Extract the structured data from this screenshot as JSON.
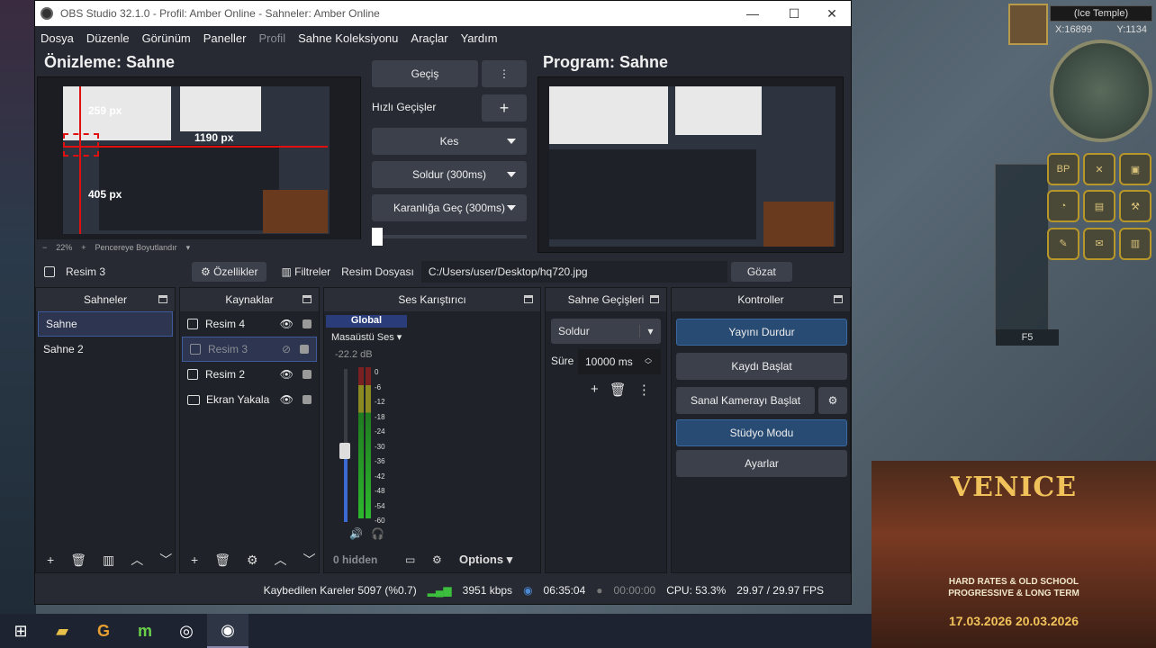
{
  "window": {
    "title": "OBS Studio 32.1.0 - Profil: Amber Online - Sahneler: Amber Online",
    "controls": {
      "minimize": "—",
      "maximize": "☐",
      "close": "✕"
    }
  },
  "menu": [
    "Dosya",
    "Düzenle",
    "Görünüm",
    "Paneller",
    "Profil",
    "Sahne Koleksiyonu",
    "Araçlar",
    "Yardım"
  ],
  "preview": {
    "title": "Önizleme: Sahne",
    "labels": {
      "top": "259 px",
      "right": "1190 px",
      "left": "405 px"
    },
    "zoom": "22%",
    "resize_label": "Pencereye Boyutlandır"
  },
  "program": {
    "title": "Program: Sahne"
  },
  "transitions": {
    "gecis": "Geçiş",
    "quick": "Hızlı Geçişler",
    "cut": "Kes",
    "fade": "Soldur (300ms)",
    "fade_black": "Karanlığa Geç (300ms)"
  },
  "sourcebar": {
    "selected": "Resim 3",
    "properties": "Özellikler",
    "filters": "Filtreler",
    "file_label": "Resim Dosyası",
    "path": "C:/Users/user/Desktop/hq720.jpg",
    "browse": "Gözat"
  },
  "scenes": {
    "header": "Sahneler",
    "items": [
      "Sahne",
      "Sahne 2"
    ]
  },
  "sources": {
    "header": "Kaynaklar",
    "items": [
      "Resim 4",
      "Resim 3",
      "Resim 2",
      "Ekran Yakala"
    ]
  },
  "mixer": {
    "header": "Ses Karıştırıcı",
    "tab": "Global",
    "device": "Masaüstü Ses",
    "level": "-22.2 dB",
    "scale": [
      "0",
      "-6",
      "-12",
      "-18",
      "-24",
      "-30",
      "-36",
      "-42",
      "-48",
      "-54",
      "-60"
    ],
    "hidden": "0 hidden",
    "options": "Options"
  },
  "scene_transitions": {
    "header": "Sahne Geçişleri",
    "type": "Soldur",
    "duration_label": "Süre",
    "duration": "10000 ms"
  },
  "controls": {
    "header": "Kontroller",
    "stop_stream": "Yayını Durdur",
    "start_record": "Kaydı Başlat",
    "virtual_cam": "Sanal Kamerayı Başlat",
    "studio_mode": "Stüdyo Modu",
    "settings": "Ayarlar"
  },
  "status": {
    "dropped": "Kaybedilen Kareler 5097 (%0.7)",
    "bitrate": "3951 kbps",
    "stream_time": "06:35:04",
    "rec_time": "00:00:00",
    "cpu": "CPU: 53.3%",
    "fps": "29.97 / 29.97 FPS"
  },
  "game": {
    "location": "(Ice Temple)",
    "x": "X:16899",
    "y": "Y:1134",
    "hotkey": "F5",
    "ad_title": "VENICE",
    "ad_line1": "HARD RATES & OLD SCHOOL",
    "ad_line2": "PROGRESSIVE & LONG TERM",
    "ad_dates": "17.03.2026   20.03.2026"
  },
  "icons": [
    "start-icon",
    "folder-icon",
    "g-app-icon",
    "m-app-icon",
    "obs-record-icon",
    "obs-icon"
  ]
}
